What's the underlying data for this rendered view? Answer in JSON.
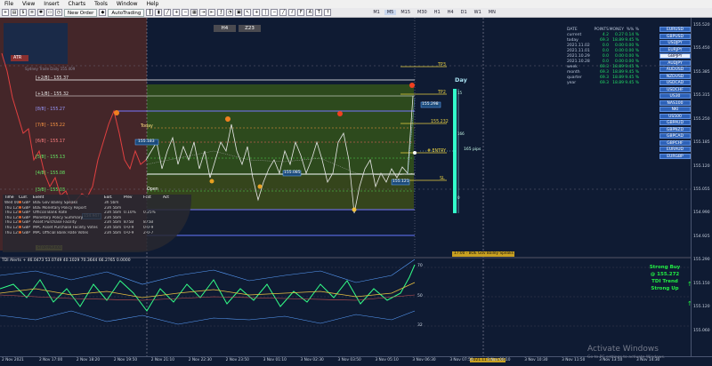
{
  "menu": [
    "File",
    "View",
    "Insert",
    "Charts",
    "Tools",
    "Window",
    "Help"
  ],
  "toolbar": {
    "new_order": "New Order",
    "autotrading": "AutoTrading",
    "timeframes": [
      "M1",
      "M5",
      "M15",
      "M30",
      "H1",
      "H4",
      "D1",
      "W1",
      "MN"
    ],
    "active_timeframe": "M5"
  },
  "chart": {
    "header_boxes": [
      "H4",
      "Z23"
    ],
    "atr_label": "ATR",
    "subtitle": "Sydney Trade Daily  155.409",
    "today": "Today",
    "open": "Open",
    "levels": [
      {
        "label": "[+2/8] - 155.37",
        "color": "#ffffff"
      },
      {
        "label": "[+1/8] - 155.32",
        "color": "#ffffff"
      },
      {
        "label": "[8/8] - 155.27",
        "color": "#7777ff"
      },
      {
        "label": "[7/8] - 155.22",
        "color": "#ff9944"
      },
      {
        "label": "[6/8] - 155.17",
        "color": "#ff6666"
      },
      {
        "label": "[5/8] - 155.13",
        "color": "#55dd55"
      },
      {
        "label": "[4/8] - 155.08",
        "color": "#55dd55"
      },
      {
        "label": "[3/8] - 155.03",
        "color": "#55dd55"
      }
    ],
    "tp_labels": [
      "TP3",
      "TP2",
      "155.232",
      "# ENTRY",
      "SL"
    ],
    "price_boxes": [
      "155.298",
      "155.183",
      "155.085",
      "155.121"
    ],
    "day_label": "Day",
    "pips": "165 pips",
    "side_nums": [
      "15",
      "166",
      "0"
    ],
    "news_strip": "17:00 - BOE Gov Bailey Speaks",
    "stop_badge": "STOP/PERIOD",
    "buttons_sample": [
      "154.947"
    ]
  },
  "stats": {
    "header": [
      "DATE",
      "POINTS",
      "MONEY",
      "%%  %"
    ],
    "rows": [
      [
        "current",
        "4.2",
        "0.27",
        "0.14 %"
      ],
      [
        "today",
        "69.3",
        "18.89",
        "9.45 %"
      ],
      [
        "2021.11.02",
        "0.0",
        "0.00",
        "0.00 %"
      ],
      [
        "2021.11.01",
        "0.0",
        "0.00",
        "0.00 %"
      ],
      [
        "2021.10.29",
        "0.0",
        "0.00",
        "0.00 %"
      ],
      [
        "2021.10.28",
        "0.0",
        "0.00",
        "0.00 %"
      ],
      [
        "week",
        "69.3",
        "18.89",
        "9.45 %"
      ],
      [
        "month",
        "69.3",
        "18.89",
        "9.45 %"
      ],
      [
        "quarter",
        "69.3",
        "18.89",
        "9.45 %"
      ],
      [
        "year",
        "69.3",
        "18.89",
        "9.45 %"
      ]
    ]
  },
  "symbols": [
    "EURUSD",
    "GBPUSD",
    "USDJPY",
    "EURJPY",
    "GBPJPY",
    "AUDJPY",
    "AUDUSD",
    "NZDUSD",
    "USDCAD",
    "USDCHF",
    "US30",
    "NAS100",
    "NKI",
    "US500",
    "GBPAUD",
    "GBPNZD",
    "GBPCAD",
    "GBPCHF",
    "EURAUD",
    "EURGBP"
  ],
  "selected_symbol": "GBPJPY",
  "news": {
    "headers": [
      "Time",
      "Curr.",
      "Event",
      "Exit.",
      "Prev",
      "Fcst",
      "Act"
    ],
    "rows": [
      [
        "Wed 00:00",
        "GBP",
        "BOE Gov Bailey Speaks",
        "3h 5bm",
        "",
        "",
        ""
      ],
      [
        "Thu 12:00",
        "GBP",
        "BOE Monetary Policy Report",
        "23h 5bm",
        "",
        "",
        ""
      ],
      [
        "Thu 12:00",
        "GBP",
        "Official Bank Rate",
        "23h 5bm",
        "0.10%",
        "0.25%",
        ""
      ],
      [
        "Thu 12:00",
        "GBP",
        "Monetary Policy Summary",
        "23h 5bm",
        "",
        "",
        ""
      ],
      [
        "Thu 12:00",
        "GBP",
        "Asset Purchase Facility",
        "23h 5bm",
        "875B",
        "875B",
        ""
      ],
      [
        "Thu 12:00",
        "GBP",
        "MPC Asset Purchase Facility Votes",
        "23h 5bm",
        "0-0-9",
        "0-0-9",
        ""
      ],
      [
        "Thu 12:00",
        "GBP",
        "MPC Official Bank Rate Votes",
        "23h 5bm",
        "0-0-9",
        "2-0-7",
        ""
      ]
    ]
  },
  "indicator": {
    "title": "TDI Alerts + 46.0473 53.0749 40.1029 70.3644 66.2765 0.0000",
    "levels": [
      "70",
      "50",
      "32"
    ],
    "signal_lines": [
      "Strong Buy",
      "@ 155.272",
      "TDI Trend",
      "Strong Up"
    ]
  },
  "price_axis": [
    "155.520",
    "155.450",
    "155.385",
    "155.315",
    "155.250",
    "155.185",
    "155.120",
    "155.055",
    "154.990",
    "154.925",
    "155.290",
    "155.150",
    "155.120",
    "155.060"
  ],
  "time_axis": [
    "2 Nov 2021",
    "2 Nov 17:00",
    "2 Nov 18:20",
    "2 Nov 19:50",
    "2 Nov 21:10",
    "2 Nov 22:30",
    "2 Nov 23:50",
    "3 Nov 01:10",
    "3 Nov 02:30",
    "3 Nov 03:50",
    "3 Nov 05:10",
    "3 Nov 06:30",
    "3 Nov 07:50",
    "3 Nov 09:10",
    "3 Nov 10:30",
    "3 Nov 11:50",
    "3 Nov 13:10",
    "3 Nov 14:30"
  ],
  "time_marker": "2021.11.03 15:00",
  "watermark": {
    "title": "Activate Windows",
    "sub": "Go to PC settings to activate Windows."
  },
  "colors": {
    "bg": "#0f1b33",
    "green_zone": "#2f4d1c",
    "red_zone": "#4a2828",
    "buy": "#22ee44"
  }
}
